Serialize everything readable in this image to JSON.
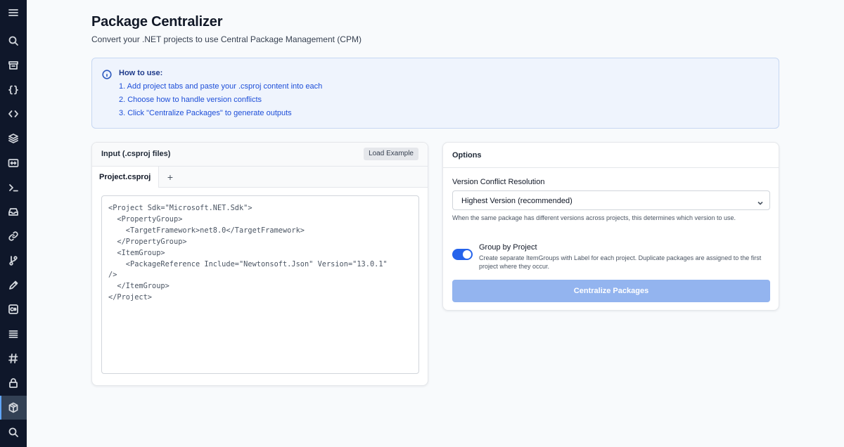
{
  "sidebar": {
    "items": [
      {
        "icon": "menu-icon"
      },
      {
        "icon": "search-icon"
      },
      {
        "icon": "archive-icon"
      },
      {
        "icon": "braces-icon"
      },
      {
        "icon": "code-icon"
      },
      {
        "icon": "layers-icon"
      },
      {
        "icon": "arrows-h-icon"
      },
      {
        "icon": "terminal-icon"
      },
      {
        "icon": "inbox-icon"
      },
      {
        "icon": "link-icon"
      },
      {
        "icon": "git-icon"
      },
      {
        "icon": "pen-icon"
      },
      {
        "icon": "csharp-icon"
      },
      {
        "icon": "list-icon"
      },
      {
        "icon": "hash-icon"
      },
      {
        "icon": "lock-icon"
      },
      {
        "icon": "package-icon",
        "active": true
      },
      {
        "icon": "search-icon"
      }
    ]
  },
  "header": {
    "title": "Package Centralizer",
    "subtitle": "Convert your .NET projects to use Central Package Management (CPM)"
  },
  "info": {
    "heading": "How to use:",
    "steps": [
      "1. Add project tabs and paste your .csproj content into each",
      "2. Choose how to handle version conflicts",
      "3. Click \"Centralize Packages\" to generate outputs"
    ]
  },
  "input_panel": {
    "title": "Input (.csproj files)",
    "load_example": "Load Example",
    "tabs": [
      {
        "label": "Project.csproj",
        "active": true
      }
    ],
    "add_tab": "+",
    "editor_content": "<Project Sdk=\"Microsoft.NET.Sdk\">\n  <PropertyGroup>\n    <TargetFramework>net8.0</TargetFramework>\n  </PropertyGroup>\n  <ItemGroup>\n    <PackageReference Include=\"Newtonsoft.Json\" Version=\"13.0.1\"\n/>\n  </ItemGroup>\n</Project>"
  },
  "options_panel": {
    "title": "Options",
    "version_label": "Version Conflict Resolution",
    "version_selected": "Highest Version (recommended)",
    "version_help": "When the same package has different versions across projects, this determines which version to use.",
    "group_title": "Group by Project",
    "group_desc": "Create separate ItemGroups with Label for each project. Duplicate packages are assigned to the first project where they occur.",
    "group_enabled": true,
    "action": "Centralize Packages"
  },
  "colors": {
    "sidebar_bg": "#0f172a",
    "accent": "#2563eb",
    "action_disabled": "#93b4ef",
    "info_bg": "#eff4fd"
  }
}
